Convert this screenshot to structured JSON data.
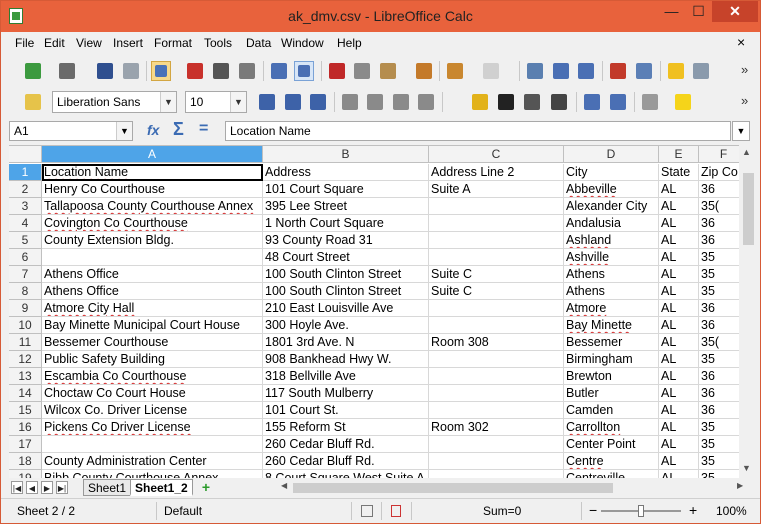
{
  "window": {
    "title": "ak_dmv.csv - LibreOffice Calc",
    "min": "—",
    "max": "☐",
    "close": "✕"
  },
  "menu": [
    "File",
    "Edit",
    "View",
    "Insert",
    "Format",
    "Tools",
    "Data",
    "Window",
    "Help"
  ],
  "menu_close": "×",
  "toolbar": {
    "more": "»"
  },
  "format": {
    "font_name": "Liberation Sans",
    "font_size": "10"
  },
  "formula": {
    "cell_ref": "A1",
    "value": "Location Name",
    "fx": "fx",
    "sum": "Σ",
    "eq": "="
  },
  "columns": [
    "A",
    "B",
    "C",
    "D",
    "E",
    "F"
  ],
  "rows": [
    {
      "n": "1",
      "a": "Location Name",
      "b": "Address",
      "c": "Address Line 2",
      "d": "City",
      "e": "State",
      "f": "Zip Co"
    },
    {
      "n": "2",
      "a": "Henry Co Courthouse",
      "b": "101 Court Square",
      "c": "Suite A",
      "d": "Abbeville",
      "e": "AL",
      "f": "36"
    },
    {
      "n": "3",
      "a": "Tallapoosa County Courthouse Annex",
      "b": "395 Lee Street",
      "c": "",
      "d": "Alexander City",
      "e": "AL",
      "f": "35("
    },
    {
      "n": "4",
      "a": "Covington Co Courthouse",
      "b": "1 North Court Square",
      "c": "",
      "d": "Andalusia",
      "e": "AL",
      "f": "36"
    },
    {
      "n": "5",
      "a": "County Extension Bldg.",
      "b": "93 County Road 31",
      "c": "",
      "d": "Ashland",
      "e": "AL",
      "f": "36"
    },
    {
      "n": "6",
      "a": "",
      "b": "48 Court Street",
      "c": "",
      "d": "Ashville",
      "e": "AL",
      "f": "35"
    },
    {
      "n": "7",
      "a": "Athens Office",
      "b": "100 South Clinton Street",
      "c": "Suite C",
      "d": "Athens",
      "e": "AL",
      "f": "35"
    },
    {
      "n": "8",
      "a": "Athens Office",
      "b": "100 South Clinton Street",
      "c": "Suite C",
      "d": "Athens",
      "e": "AL",
      "f": "35"
    },
    {
      "n": "9",
      "a": "Atmore City Hall",
      "b": "210 East Louisville Ave",
      "c": "",
      "d": "Atmore",
      "e": "AL",
      "f": "36"
    },
    {
      "n": "10",
      "a": "Bay Minette Municipal Court House",
      "b": "300 Hoyle Ave.",
      "c": "",
      "d": "Bay Minette",
      "e": "AL",
      "f": "36"
    },
    {
      "n": "11",
      "a": "Bessemer Courthouse",
      "b": "1801 3rd Ave. N",
      "c": "Room 308",
      "d": "Bessemer",
      "e": "AL",
      "f": "35("
    },
    {
      "n": "12",
      "a": "Public Safety Building",
      "b": "908 Bankhead Hwy W.",
      "c": "",
      "d": "Birmingham",
      "e": "AL",
      "f": "35"
    },
    {
      "n": "13",
      "a": "Escambia Co Courthouse",
      "b": "318 Bellville Ave",
      "c": "",
      "d": "Brewton",
      "e": "AL",
      "f": "36"
    },
    {
      "n": "14",
      "a": "Choctaw Co Court House",
      "b": "117 South Mulberry",
      "c": "",
      "d": "Butler",
      "e": "AL",
      "f": "36"
    },
    {
      "n": "15",
      "a": "Wilcox Co. Driver License",
      "b": "101 Court St.",
      "c": "",
      "d": "Camden",
      "e": "AL",
      "f": "36"
    },
    {
      "n": "16",
      "a": "Pickens Co Driver License",
      "b": "155 Reform St",
      "c": "Room 302",
      "d": "Carrollton",
      "e": "AL",
      "f": "35"
    },
    {
      "n": "17",
      "a": "",
      "b": "260 Cedar Bluff Rd.",
      "c": "",
      "d": "Center Point",
      "e": "AL",
      "f": "35"
    },
    {
      "n": "18",
      "a": "County Administration Center",
      "b": "260 Cedar Bluff Rd.",
      "c": "",
      "d": "Centre",
      "e": "AL",
      "f": "35"
    },
    {
      "n": "19",
      "a": "Bibb County Courthouse Annex",
      "b": "8 Court Square West Suite A",
      "c": "",
      "d": "Centreville",
      "e": "AL",
      "f": "35"
    }
  ],
  "sheets": [
    {
      "label": "Sheet1"
    },
    {
      "label": "Sheet1_2"
    }
  ],
  "add_sheet": "+",
  "status": {
    "sheet": "Sheet 2 / 2",
    "style": "Default",
    "sum": "Sum=0",
    "zoom_minus": "−",
    "zoom_plus": "+",
    "zoom": "100%",
    "zoom_level": 1.0
  },
  "colors": {
    "title_bar": "#e8623c",
    "selection_header": "#4ea4e8",
    "spell_underline": "#d42b2b"
  }
}
